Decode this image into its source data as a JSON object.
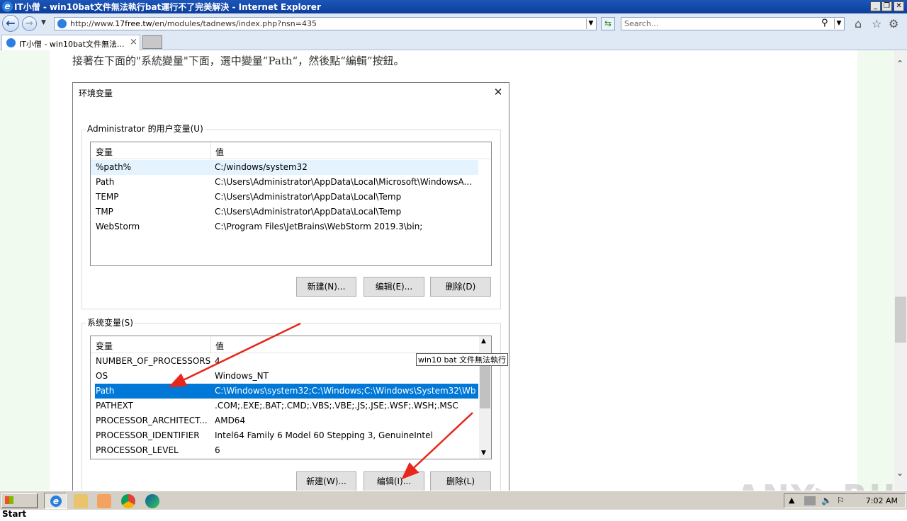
{
  "window": {
    "title": "IT小僧 - win10bat文件無法執行bat運行不了完美解決 - Internet Explorer",
    "minimize": "_",
    "restore": "❐",
    "close": "✕"
  },
  "address": {
    "url_prefix": "http://www.",
    "url_domain": "17free.tw",
    "url_rest": "/en/modules/tadnews/index.php?nsn=435",
    "search_placeholder": "Search..."
  },
  "tabs": [
    {
      "label": "IT小僧 - win10bat文件無法...",
      "close": "×"
    }
  ],
  "page": {
    "instruction": "接著在下面的\"系統變量\"下面，選中變量”Path“，然後點“編輯”按鈕。"
  },
  "dialog": {
    "title": "环境变量",
    "close": "✕",
    "user_group_label": "Administrator 的用户变量(U)",
    "sys_group_label": "系统变量(S)",
    "col_var": "变量",
    "col_val": "值",
    "user_rows": [
      {
        "name": "%path%",
        "value": "C:/windows/system32"
      },
      {
        "name": "Path",
        "value": "C:\\Users\\Administrator\\AppData\\Local\\Microsoft\\WindowsA..."
      },
      {
        "name": "TEMP",
        "value": "C:\\Users\\Administrator\\AppData\\Local\\Temp"
      },
      {
        "name": "TMP",
        "value": "C:\\Users\\Administrator\\AppData\\Local\\Temp"
      },
      {
        "name": "WebStorm",
        "value": "C:\\Program Files\\JetBrains\\WebStorm 2019.3\\bin;"
      }
    ],
    "sys_rows": [
      {
        "name": "NUMBER_OF_PROCESSORS",
        "value": "4"
      },
      {
        "name": "OS",
        "value": "Windows_NT"
      },
      {
        "name": "Path",
        "value": "C:\\Windows\\system32;C:\\Windows;C:\\Windows\\System32\\Wb..."
      },
      {
        "name": "PATHEXT",
        "value": ".COM;.EXE;.BAT;.CMD;.VBS;.VBE;.JS;.JSE;.WSF;.WSH;.MSC"
      },
      {
        "name": "PROCESSOR_ARCHITECT...",
        "value": "AMD64"
      },
      {
        "name": "PROCESSOR_IDENTIFIER",
        "value": "Intel64 Family 6 Model 60 Stepping 3, GenuineIntel"
      },
      {
        "name": "PROCESSOR_LEVEL",
        "value": "6"
      }
    ],
    "user_buttons": {
      "new": "新建(N)...",
      "edit": "编辑(E)...",
      "delete": "删除(D)"
    },
    "sys_buttons": {
      "new": "新建(W)...",
      "edit": "编辑(I)...",
      "delete": "删除(L)"
    }
  },
  "tooltip": "win10 bat 文件無法執行",
  "watermark": "ANY▷RUN",
  "home_button": "首頁",
  "taskbar": {
    "start": "Start",
    "clock": "7:02 AM"
  },
  "colors": {
    "selection": "#0078d7",
    "annotation_arrow": "#e8261b",
    "titlebar": "#0c3e9c"
  }
}
